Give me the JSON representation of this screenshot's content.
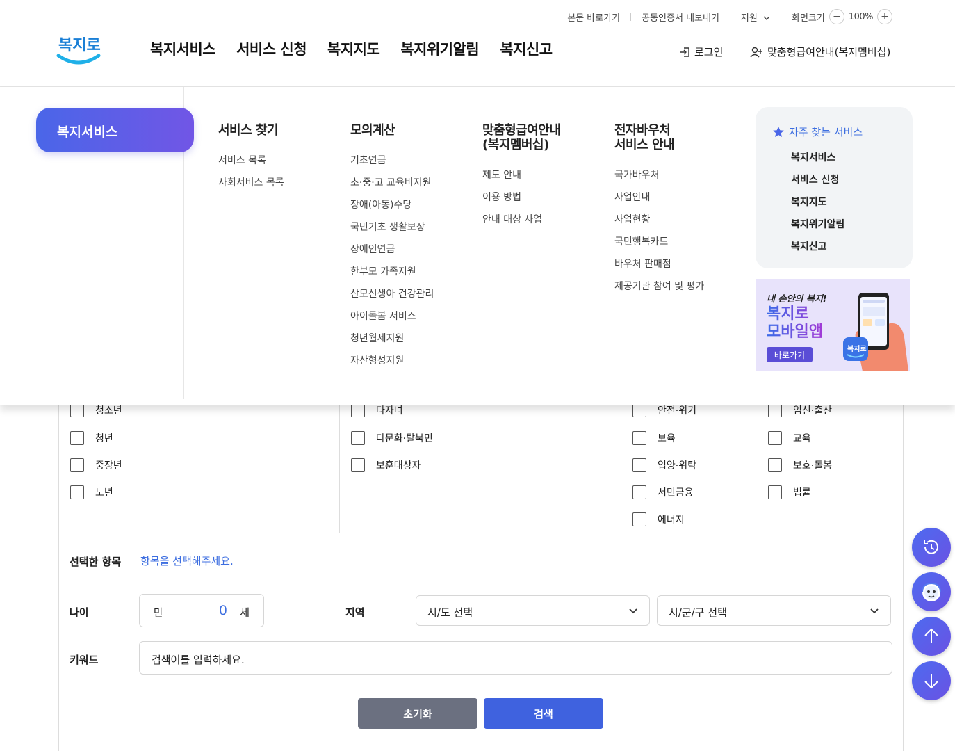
{
  "utility": {
    "skip": "본문 바로가기",
    "cert": "공동인증서 내보내기",
    "support": "지원",
    "screen_size": "화면크기",
    "zoom": "100%"
  },
  "header": {
    "logo_text": "복지로",
    "nav": [
      "복지서비스",
      "서비스 신청",
      "복지지도",
      "복지위기알림",
      "복지신고"
    ],
    "login": "로그인",
    "membership": "맞춤형급여안내(복지멤버십)"
  },
  "mega_menu": {
    "active": "복지서비스",
    "columns": [
      {
        "title": "서비스 찾기",
        "items": [
          "서비스 목록",
          "사회서비스 목록"
        ]
      },
      {
        "title": "모의계산",
        "items": [
          "기초연금",
          "초·중·고 교육비지원",
          "장애(아동)수당",
          "국민기초 생활보장",
          "장애인연금",
          "한부모 가족지원",
          "산모신생아 건강관리",
          "아이돌봄 서비스",
          "청년월세지원",
          "자산형성지원"
        ]
      },
      {
        "title": "맞춤형급여안내\n(복지멤버십)",
        "items": [
          "제도 안내",
          "이용 방법",
          "안내 대상 사업"
        ]
      },
      {
        "title": "전자바우처\n서비스 안내",
        "items": [
          "국가바우처",
          "사업안내",
          "사업현황",
          "국민행복카드",
          "바우처 판매점",
          "제공기관 참여 및 평가"
        ]
      }
    ],
    "favorites": {
      "title": "자주 찾는 서비스",
      "items": [
        "복지서비스",
        "서비스 신청",
        "복지지도",
        "복지위기알림",
        "복지신고"
      ]
    },
    "banner": {
      "line1": "내 손안의 복지!",
      "line2": "복지로",
      "line3": "모바일앱",
      "button": "바로가기"
    }
  },
  "filters": {
    "col1": [
      "청소년",
      "청년",
      "중장년",
      "노년"
    ],
    "col2": [
      "다자녀",
      "다문화·탈북민",
      "보훈대상자"
    ],
    "col3": [
      "안전·위기",
      "보육",
      "입양·위탁",
      "서민금융",
      "에너지"
    ],
    "col4": [
      "임신·출산",
      "교육",
      "보호·돌봄",
      "법률"
    ]
  },
  "search": {
    "selected_label": "선택한 항목",
    "selected_value": "항목을 선택해주세요.",
    "age_label": "나이",
    "age_prefix": "만",
    "age_value": "0",
    "age_suffix": "세",
    "region_label": "지역",
    "sido": "시/도 선택",
    "sigungu": "시/군/구 선택",
    "keyword_label": "키워드",
    "keyword_placeholder": "검색어를 입력하세요.",
    "reset": "초기화",
    "submit": "검색"
  },
  "colors": {
    "primary": "#3d6ee0",
    "reset_btn": "#6b7080",
    "search_btn": "#3f62df"
  }
}
